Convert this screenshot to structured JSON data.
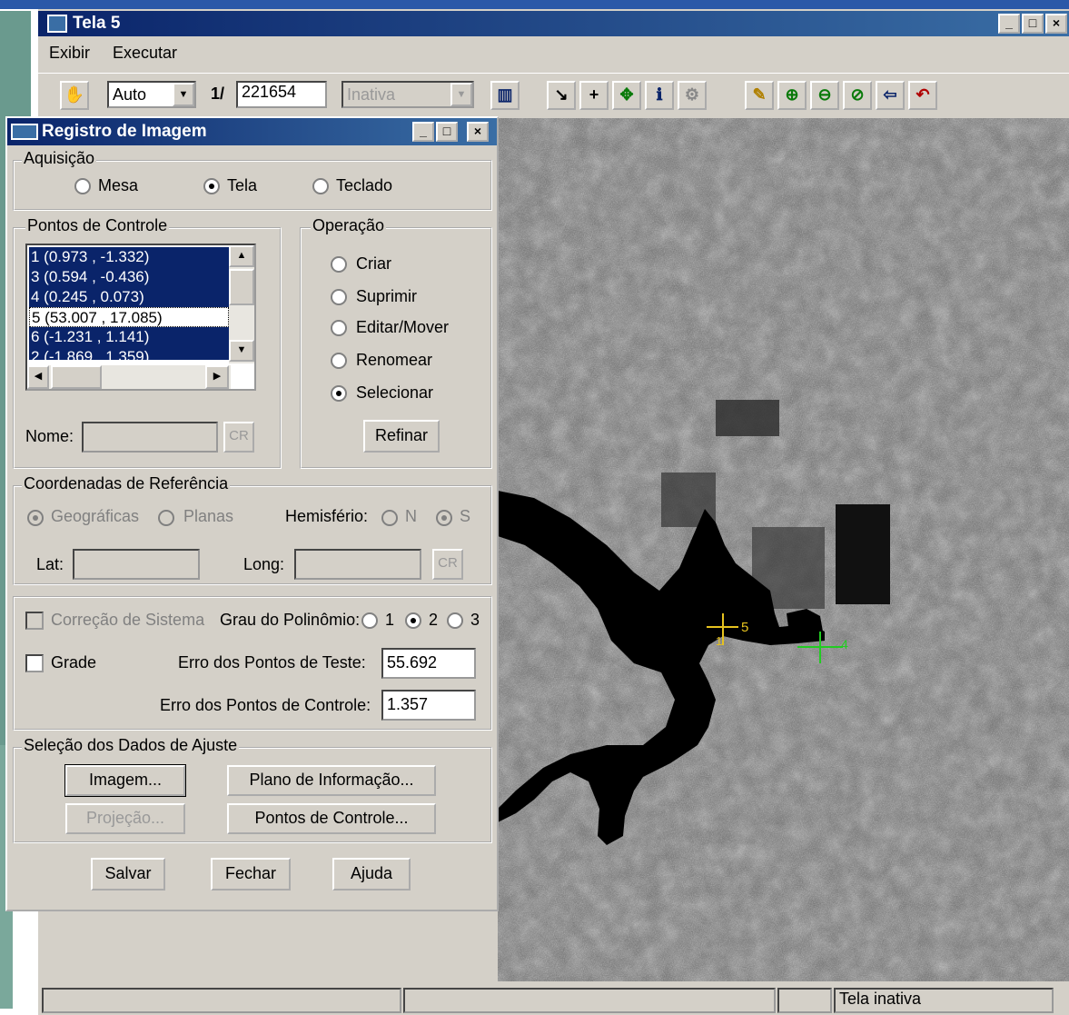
{
  "main_window": {
    "title": "Tela 5",
    "min_label": "_",
    "max_label": "□",
    "close_label": "×",
    "menu": [
      "Exibir",
      "Executar"
    ],
    "toolbar": {
      "zoom_mode": "Auto",
      "scale_prefix": "1/",
      "scale_value": "221654",
      "status_combo": "Inativa"
    },
    "status_bar": {
      "cells": [
        "",
        "",
        "",
        "Tela inativa"
      ]
    }
  },
  "dialog": {
    "title": "Registro de Imagem",
    "aquisicao": {
      "label": "Aquisição",
      "options": [
        "Mesa",
        "Tela",
        "Teclado"
      ],
      "selected": "Tela"
    },
    "pontos_controle": {
      "label": "Pontos de Controle",
      "items": [
        {
          "text": "1 (0.973 , -1.332)",
          "selected": true
        },
        {
          "text": "3 (0.594 , -0.436)",
          "selected": true
        },
        {
          "text": "4 (0.245 , 0.073)",
          "selected": true
        },
        {
          "text": "5 (53.007 , 17.085)",
          "selected": false
        },
        {
          "text": "6 (-1.231 , 1.141)",
          "selected": true
        },
        {
          "text": "2 (-1.869 , 1.359)",
          "selected": true
        }
      ],
      "nome_label": "Nome:",
      "nome_value": "",
      "cr_label": "CR"
    },
    "operacao": {
      "label": "Operação",
      "options": [
        "Criar",
        "Suprimir",
        "Editar/Mover",
        "Renomear",
        "Selecionar"
      ],
      "selected": "Selecionar",
      "refinar_label": "Refinar"
    },
    "coordenadas": {
      "label": "Coordenadas de Referência",
      "geograficas": "Geográficas",
      "planas": "Planas",
      "hemisferio_label": "Hemisfério:",
      "hemisferio_n": "N",
      "hemisferio_s": "S",
      "lat_label": "Lat:",
      "lat_value": "",
      "long_label": "Long:",
      "long_value": "",
      "cr_label": "CR"
    },
    "ajuste": {
      "correcao_label": "Correção de Sistema",
      "grau_label": "Grau do Polinômio:",
      "grau_options": [
        "1",
        "2",
        "3"
      ],
      "grau_selected": "2",
      "grade_label": "Grade",
      "erro_teste_label": "Erro dos Pontos de Teste:",
      "erro_teste_value": "55.692",
      "erro_controle_label": "Erro dos Pontos de Controle:",
      "erro_controle_value": "1.357"
    },
    "selecao": {
      "label": "Seleção dos Dados de Ajuste",
      "imagem_button": "Imagem...",
      "plano_button": "Plano de Informação...",
      "projecao_button": "Projeção...",
      "pontos_button": "Pontos de Controle..."
    },
    "footer": {
      "salvar": "Salvar",
      "fechar": "Fechar",
      "ajuda": "Ajuda"
    }
  },
  "map_markers": {
    "marker_a_label": "5",
    "marker_a_sub": "1",
    "marker_b_label": "4",
    "marker_a_color": "#e6c21f",
    "marker_b_color": "#22cc22"
  }
}
